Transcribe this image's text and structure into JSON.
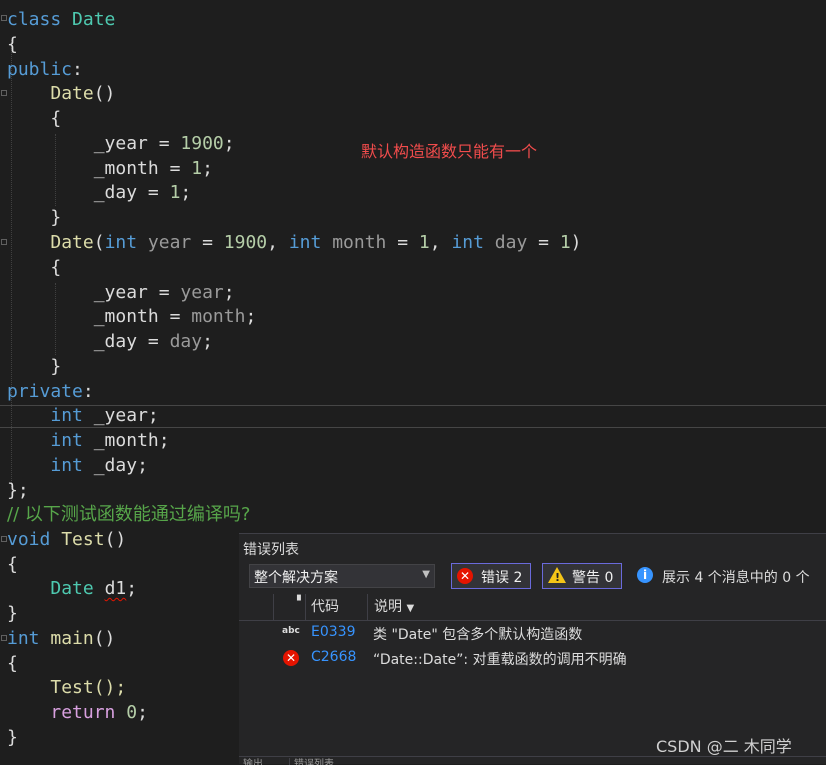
{
  "code": {
    "class_kw": "class",
    "class_name": "Date",
    "open_brace": "{",
    "close_brace_semi": "};",
    "close_brace": "}",
    "public_kw": "public",
    "private_kw": "private",
    "colon": ":",
    "ctor_name": "Date",
    "empty_parens": "()",
    "year_member": "_year",
    "month_member": "_month",
    "day_member": "_day",
    "assign": " = ",
    "semi": ";",
    "year_default": "1900",
    "month_default": "1",
    "day_default": "1",
    "int_kw": "int",
    "year_param": "year",
    "month_param": "month",
    "day_param": "day",
    "comment": "// 以下测试函数能通过编译吗?",
    "void_kw": "void",
    "test_fn": "Test",
    "date_type": "Date",
    "d1_var": "d1",
    "main_fn": "main",
    "return_kw": "return",
    "zero": "0",
    "test_call": "Test();"
  },
  "annotation": "默认构造函数只能有一个",
  "error_list": {
    "title": "错误列表",
    "scope": "整个解决方案",
    "errors_btn": "错误 2",
    "warnings_btn": "警告 0",
    "info_text": "展示 4 个消息中的 0 个",
    "col_code": "代码",
    "col_desc": "说明",
    "rows": [
      {
        "icon": "spell-check-icon",
        "code": "E0339",
        "desc": "类 \"Date\" 包含多个默认构造函数"
      },
      {
        "icon": "error-icon",
        "code": "C2668",
        "desc": "“Date::Date”: 对重载函数的调用不明确"
      }
    ],
    "tabs": [
      "输出",
      "错误列表"
    ]
  },
  "watermark": "CSDN @二 木同学",
  "colors": {
    "background": "#1e1e1e",
    "keyword": "#569cd6",
    "type": "#4ec9b0",
    "function": "#dcdcaa",
    "number": "#b5cea8",
    "comment": "#57a64a",
    "error": "#e51400",
    "annotation": "#f14c4c"
  }
}
